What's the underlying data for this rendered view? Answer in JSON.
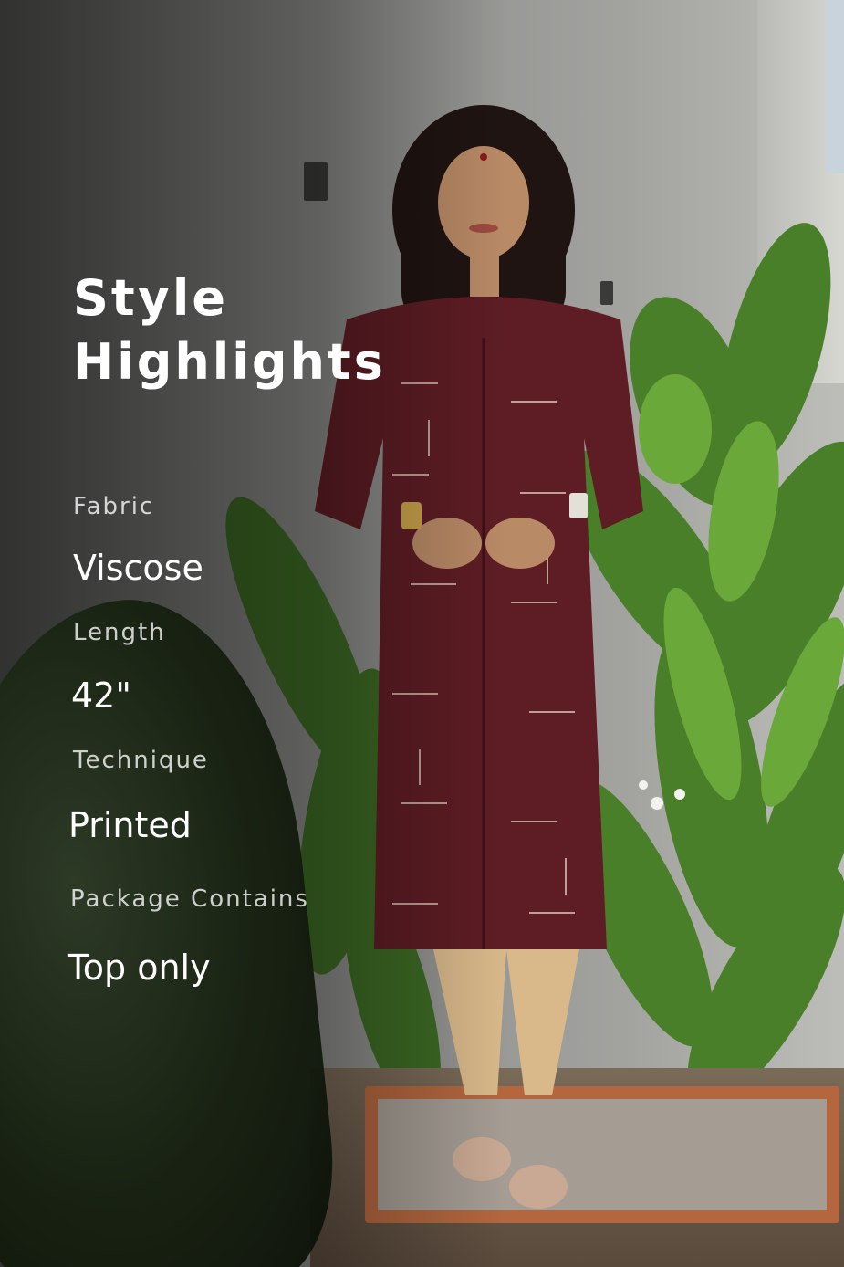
{
  "heading": {
    "line1": "Style",
    "line2": "Highlights"
  },
  "specs": [
    {
      "label": "Fabric",
      "value": "Viscose"
    },
    {
      "label": "Length",
      "value": "42\""
    },
    {
      "label": "Technique",
      "value": "Printed"
    },
    {
      "label": "Package Contains",
      "value": "Top only"
    }
  ],
  "photo": {
    "kurta_color": "#5e1d24",
    "leggings_color": "#d9b98a",
    "foliage_color": "#4f8a2c"
  }
}
